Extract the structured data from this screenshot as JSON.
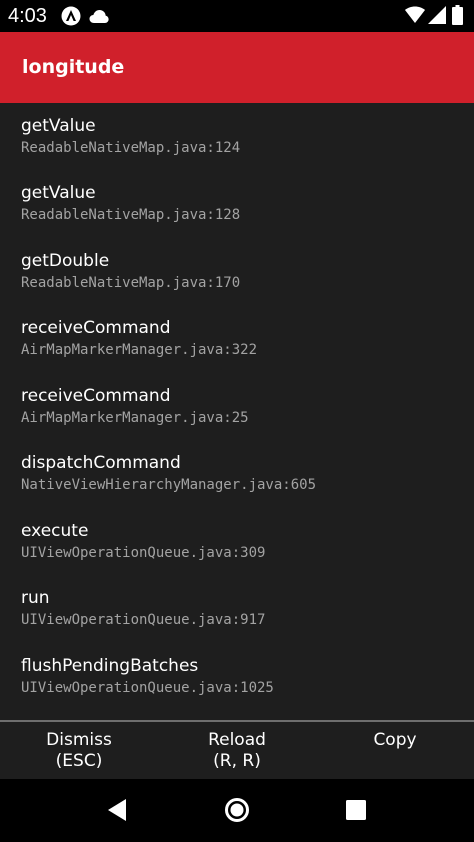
{
  "status_bar": {
    "time": "4:03",
    "icons": [
      "react-native-app-icon",
      "cloud-icon",
      "wifi-icon",
      "cell-signal-icon",
      "battery-icon"
    ]
  },
  "header": {
    "title": "longitude",
    "background_color": "#d0202b"
  },
  "stack_frames": [
    {
      "method": "getValue",
      "file": "ReadableNativeMap.java:124"
    },
    {
      "method": "getValue",
      "file": "ReadableNativeMap.java:128"
    },
    {
      "method": "getDouble",
      "file": "ReadableNativeMap.java:170"
    },
    {
      "method": "receiveCommand",
      "file": "AirMapMarkerManager.java:322"
    },
    {
      "method": "receiveCommand",
      "file": "AirMapMarkerManager.java:25"
    },
    {
      "method": "dispatchCommand",
      "file": "NativeViewHierarchyManager.java:605"
    },
    {
      "method": "execute",
      "file": "UIViewOperationQueue.java:309"
    },
    {
      "method": "run",
      "file": "UIViewOperationQueue.java:917"
    },
    {
      "method": "flushPendingBatches",
      "file": "UIViewOperationQueue.java:1025"
    }
  ],
  "buttons": {
    "dismiss": {
      "label": "Dismiss",
      "shortcut": "(ESC)"
    },
    "reload": {
      "label": "Reload",
      "shortcut": "(R, R)"
    },
    "copy": {
      "label": "Copy"
    }
  },
  "nav_bar": {
    "icons": [
      "back-icon",
      "home-icon",
      "recents-icon"
    ]
  }
}
